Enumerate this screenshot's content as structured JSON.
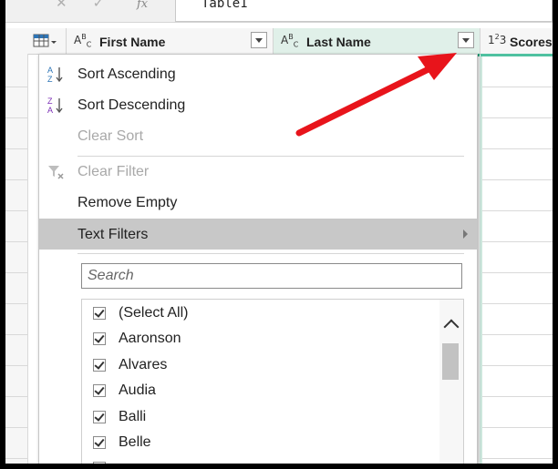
{
  "formula_bar": {
    "text": "Table1"
  },
  "columns": [
    {
      "type_icon": "ABC",
      "name": "First Name"
    },
    {
      "type_icon": "ABC",
      "name": "Last Name"
    },
    {
      "type_icon": "123",
      "name": "Scores"
    }
  ],
  "menu": {
    "items": [
      {
        "label": "Sort Ascending",
        "icon": "sort-az-icon",
        "disabled": false
      },
      {
        "label": "Sort Descending",
        "icon": "sort-za-icon",
        "disabled": false
      },
      {
        "label": "Clear Sort",
        "disabled": true
      },
      {
        "label": "Clear Filter",
        "icon": "clear-filter-icon",
        "disabled": true
      },
      {
        "label": "Remove Empty",
        "disabled": false
      },
      {
        "label": "Text Filters",
        "highlighted": true,
        "has_submenu": true
      }
    ],
    "search_placeholder": "Search",
    "values": [
      "(Select All)",
      "Aaronson",
      "Alvares",
      "Audia",
      "Balli",
      "Belle"
    ]
  },
  "colors": {
    "highlight": "#c8c8c8",
    "active_column": "#e0f0e9",
    "accent_green": "#21a47a",
    "annotation_arrow": "#e8141b"
  }
}
